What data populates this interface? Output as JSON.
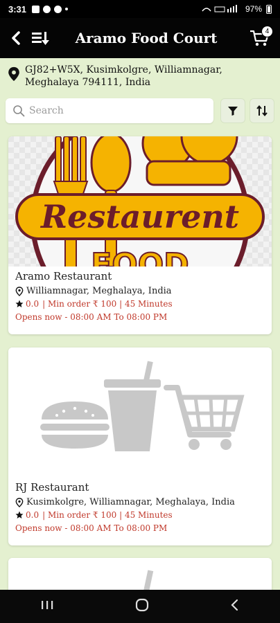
{
  "status_bar": {
    "time": "3:31",
    "battery": "97%"
  },
  "app_bar": {
    "title": "Aramo Food Court",
    "cart_count": "4"
  },
  "location": {
    "address": "GJ82+W5X, Kusimkolgre, Williamnagar, Meghalaya 794111, India"
  },
  "search": {
    "placeholder": "Search"
  },
  "restaurants": [
    {
      "name": "Aramo Restaurant",
      "location": "Williamnagar, Meghalaya, India",
      "rating": "0.0",
      "meta_rest": "| Min order ₹ 100 | 45 Minutes",
      "opens": "Opens now - 08:00 AM To 08:00 PM",
      "image_text": "Restaurent",
      "image_text_2": "FOOD"
    },
    {
      "name": "RJ Restaurant",
      "location": "Kusimkolgre, Williamnagar, Meghalaya, India",
      "rating": "0.0",
      "meta_rest": "| Min order ₹ 100 | 45 Minutes",
      "opens": "Opens now - 08:00 AM To 08:00 PM"
    }
  ],
  "colors": {
    "accent_red": "#c0392b",
    "logo_yellow": "#f5b301",
    "logo_maroon": "#6b1d2b",
    "bg_green": "#e4f0d0"
  }
}
